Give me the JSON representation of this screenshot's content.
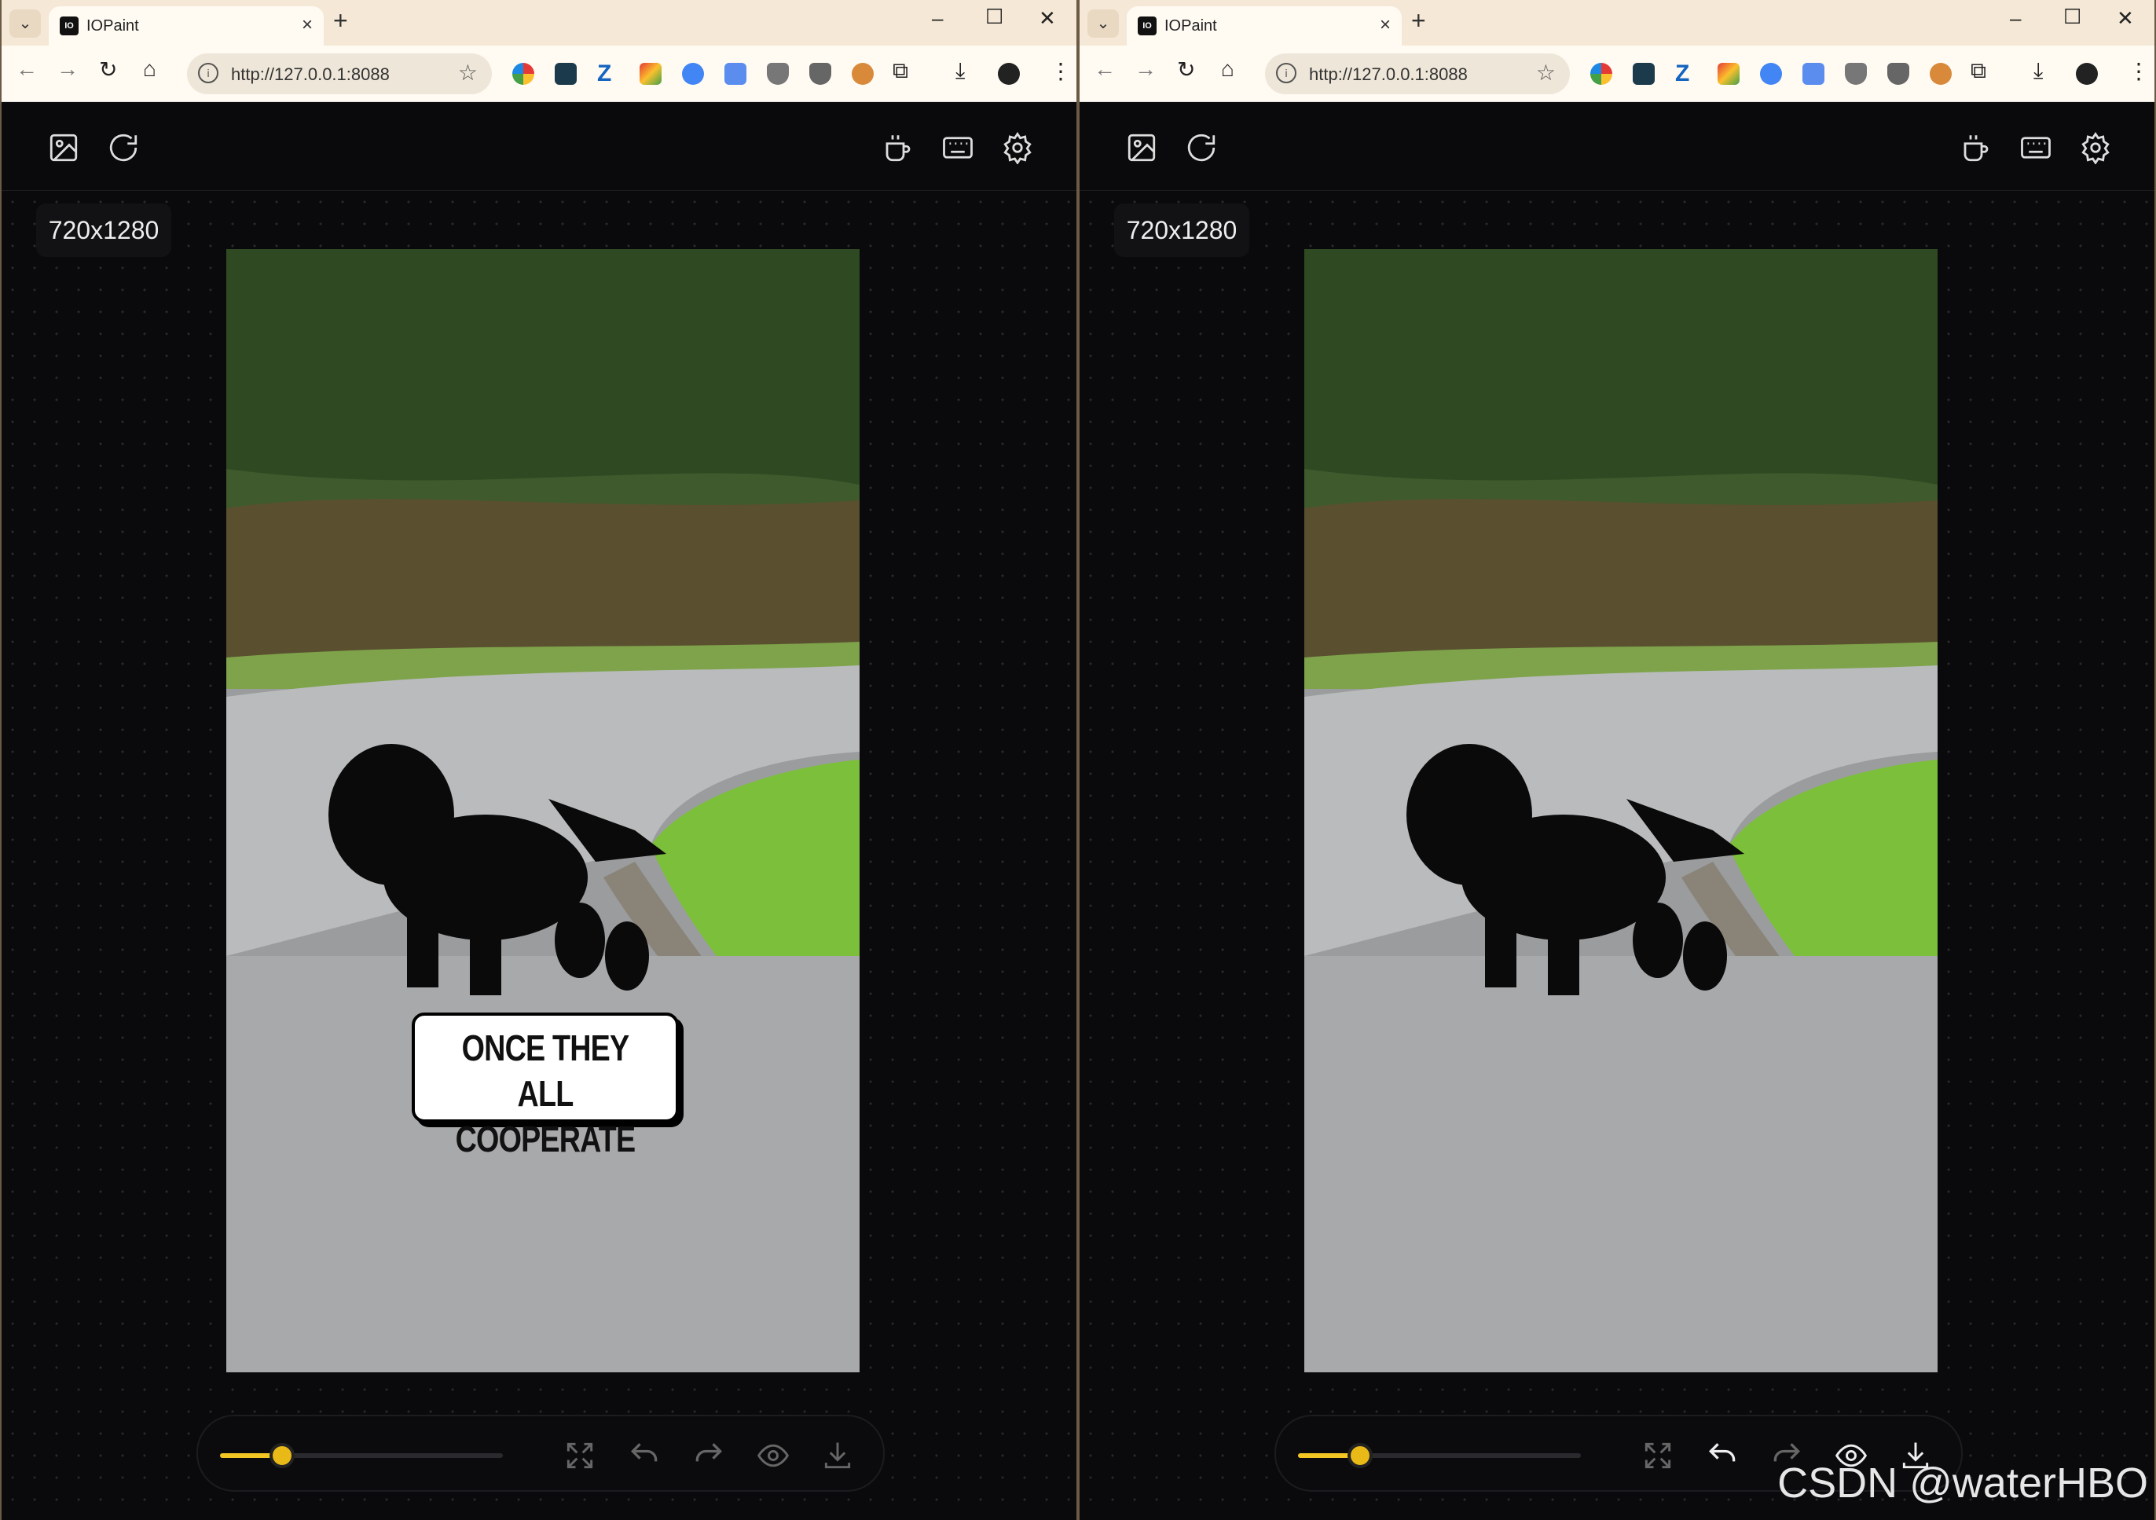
{
  "panes": [
    {
      "browser": {
        "tab_title": "IOPaint",
        "favicon_text": "IO",
        "url": "http://127.0.0.1:8088",
        "accent": "#f5e8d6"
      },
      "app": {
        "size_label": "720x1280",
        "caption_line1": "ONCE THEY ALL",
        "caption_line2": "COOPERATE",
        "brush_size_fraction": 0.22,
        "undo_enabled": false,
        "redo_enabled": false
      }
    },
    {
      "browser": {
        "tab_title": "IOPaint",
        "favicon_text": "IO",
        "url": "http://127.0.0.1:8088",
        "accent": "#f5e8d6"
      },
      "app": {
        "size_label": "720x1280",
        "caption_line1": "",
        "caption_line2": "",
        "brush_size_fraction": 0.22,
        "undo_enabled": true,
        "redo_enabled": false
      }
    }
  ],
  "icons": {
    "header_left": [
      "image-upload-icon",
      "refresh-icon"
    ],
    "header_right": [
      "coffee-icon",
      "keyboard-icon",
      "settings-gear-icon"
    ],
    "bottom": [
      "fullscreen-icon",
      "undo-icon",
      "redo-icon",
      "eye-icon",
      "download-icon"
    ]
  },
  "colors": {
    "slider": "#f3c623",
    "app_bg": "#0a0a0c"
  },
  "watermark": "CSDN @waterHBO"
}
